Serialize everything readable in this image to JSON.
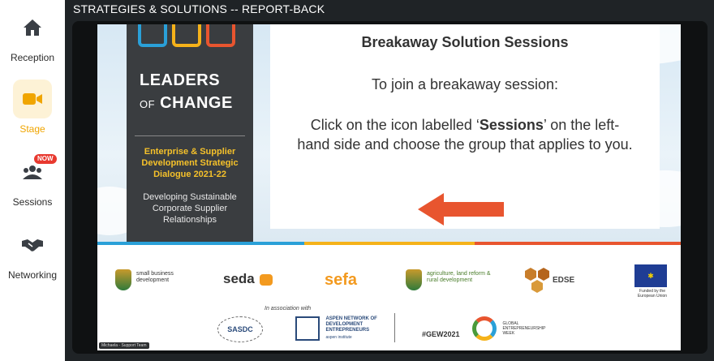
{
  "sidebar": {
    "items": [
      {
        "label": "Reception",
        "icon": "home-icon",
        "active": false
      },
      {
        "label": "Stage",
        "icon": "video-camera-icon",
        "active": true
      },
      {
        "label": "Sessions",
        "icon": "sessions-group-icon",
        "active": false,
        "badge": "NOW"
      },
      {
        "label": "Networking",
        "icon": "handshake-icon",
        "active": false
      }
    ]
  },
  "stage": {
    "title": "STRATEGIES & SOLUTIONS -- REPORT-BACK"
  },
  "slide": {
    "panel": {
      "leaders": "LEADERS",
      "of": "OF",
      "change": "CHANGE",
      "dialogue": "Enterprise & Supplier Development Strategic Dialogue 2021-22",
      "subtitle": "Developing Sustainable Corporate Supplier Relationships"
    },
    "card": {
      "heading": "Breakaway Solution Sessions",
      "join": "To join a breakaway session:",
      "instr_pre": "Click on the icon labelled ‘",
      "instr_bold": "Sessions",
      "instr_post": "’ on the left-hand side and choose the group that applies to you."
    },
    "logos": {
      "sbd": "small business development",
      "seda": "seda",
      "sefa": "sefa",
      "agri": "agriculture, land reform & rural development",
      "edse": "EDSE",
      "eu": "Funded by the European Union",
      "assoc": "In association with",
      "sasdc": "SASDC",
      "aspen": "ASPEN NETWORK OF DEVELOPMENT ENTREPRENEURS",
      "aspen_sub": "aspen institute",
      "gew": "#GEW2021",
      "gew_week": "GLOBAL ENTREPRENEURSHIP WEEK"
    },
    "speaker_caption": "Michaela - Support Team"
  },
  "colors": {
    "accent": "#f0a500",
    "badge": "#e8392f",
    "stage_bg": "#1f2326",
    "arrow": "#e8552f"
  }
}
